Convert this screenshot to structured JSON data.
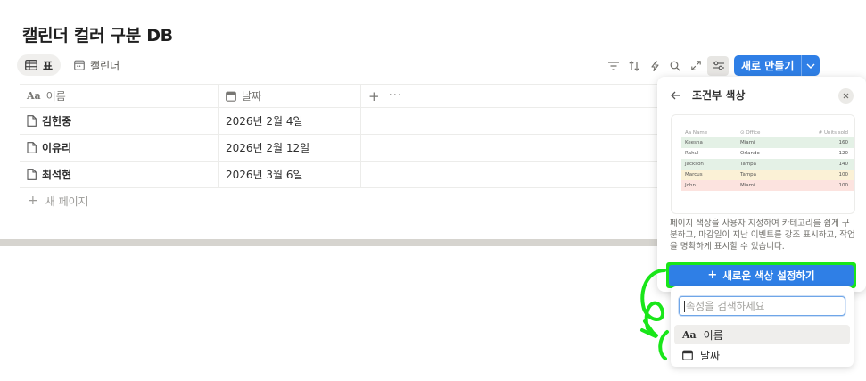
{
  "page": {
    "title": "캘린더 컬러 구분 DB"
  },
  "views": [
    {
      "label": "표",
      "icon": "table-icon",
      "active": true
    },
    {
      "label": "캘린더",
      "icon": "calendar-icon",
      "active": false
    }
  ],
  "toolbar": {
    "icons": [
      "filter-icon",
      "sort-icon",
      "automation-icon",
      "search-icon",
      "expand-icon",
      "settings-icon"
    ],
    "new_label": "새로 만들기"
  },
  "table": {
    "columns": [
      {
        "label": "이름",
        "icon": "text-property-icon"
      },
      {
        "label": "날짜",
        "icon": "calendar-icon"
      }
    ],
    "rows": [
      {
        "name": "김헌중",
        "date": "2026년 2월 4일"
      },
      {
        "name": "이유리",
        "date": "2026년 2월 12일"
      },
      {
        "name": "최석현",
        "date": "2026년 3월 6일"
      }
    ],
    "add_label": "새 페이지"
  },
  "panel": {
    "title": "조건부 색상",
    "description": "페이지 색상을 사용자 지정하여 카테고리를 쉽게 구분하고, 마감일이 지난 이벤트를 강조 표시하고, 작업을 명확하게 표시할 수 있습니다.",
    "cta_label": "새로운 색상 설정하기",
    "preview": {
      "headers": [
        "Name",
        "Office",
        "Units sold"
      ],
      "rows": [
        {
          "name": "Keesha",
          "office": "Miami",
          "units": "160",
          "color": "#e4f1e6"
        },
        {
          "name": "Rahul",
          "office": "Orlando",
          "units": "120",
          "color": "#ffffff"
        },
        {
          "name": "Jackson",
          "office": "Tampa",
          "units": "140",
          "color": "#e4f1e6"
        },
        {
          "name": "Marcus",
          "office": "Tampa",
          "units": "100",
          "color": "#fbf1d6"
        },
        {
          "name": "John",
          "office": "Miami",
          "units": "100",
          "color": "#fce3df"
        }
      ]
    }
  },
  "dropdown": {
    "placeholder": "속성을 검색하세요",
    "options": [
      {
        "label": "이름",
        "icon": "text-property-icon"
      },
      {
        "label": "날짜",
        "icon": "calendar-icon"
      }
    ]
  },
  "colors": {
    "accent": "#2f7fe6",
    "highlight": "#19e619"
  }
}
